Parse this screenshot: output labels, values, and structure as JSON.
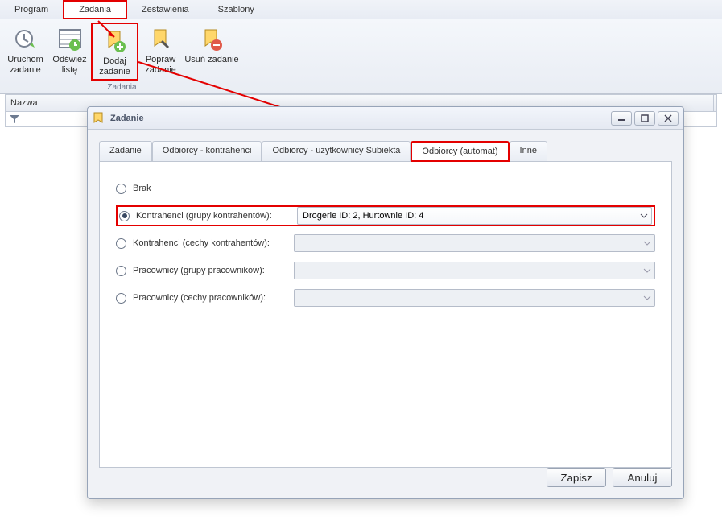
{
  "menu": {
    "items": [
      "Program",
      "Zadania",
      "Zestawienia",
      "Szablony"
    ],
    "active_index": 1
  },
  "ribbon": {
    "buttons": [
      {
        "name": "uruchom-zadanie",
        "line1": "Uruchom",
        "line2": "zadanie",
        "icon": "clock-run"
      },
      {
        "name": "odswiez-liste",
        "line1": "Odśwież",
        "line2": "listę",
        "icon": "refresh-grid"
      },
      {
        "name": "dodaj-zadanie",
        "line1": "Dodaj",
        "line2": "zadanie",
        "icon": "bookmark-add"
      },
      {
        "name": "popraw-zadanie",
        "line1": "Popraw",
        "line2": "zadanie",
        "icon": "bookmark-edit"
      },
      {
        "name": "usun-zadanie",
        "line1": "Usuń zadanie",
        "line2": "",
        "icon": "bookmark-delete"
      }
    ],
    "group_caption": "Zadania",
    "highlight_index": 2
  },
  "grid": {
    "col0": "Nazwa"
  },
  "modal": {
    "title": "Zadanie",
    "tabs": [
      "Zadanie",
      "Odbiorcy - kontrahenci",
      "Odbiorcy - użytkownicy Subiekta",
      "Odbiorcy (automat)",
      "Inne"
    ],
    "active_tab_index": 3,
    "options": {
      "brak": "Brak",
      "kontrahenci_grupy": "Kontrahenci (grupy kontrahentów):",
      "kontrahenci_cechy": "Kontrahenci (cechy kontrahentów):",
      "pracownicy_grupy": "Pracownicy (grupy pracowników):",
      "pracownicy_cechy": "Pracownicy (cechy pracowników):"
    },
    "kontrahenci_grupy_value": "Drogerie ID: 2, Hurtownie ID: 4",
    "footer": {
      "save": "Zapisz",
      "cancel": "Anuluj"
    }
  }
}
